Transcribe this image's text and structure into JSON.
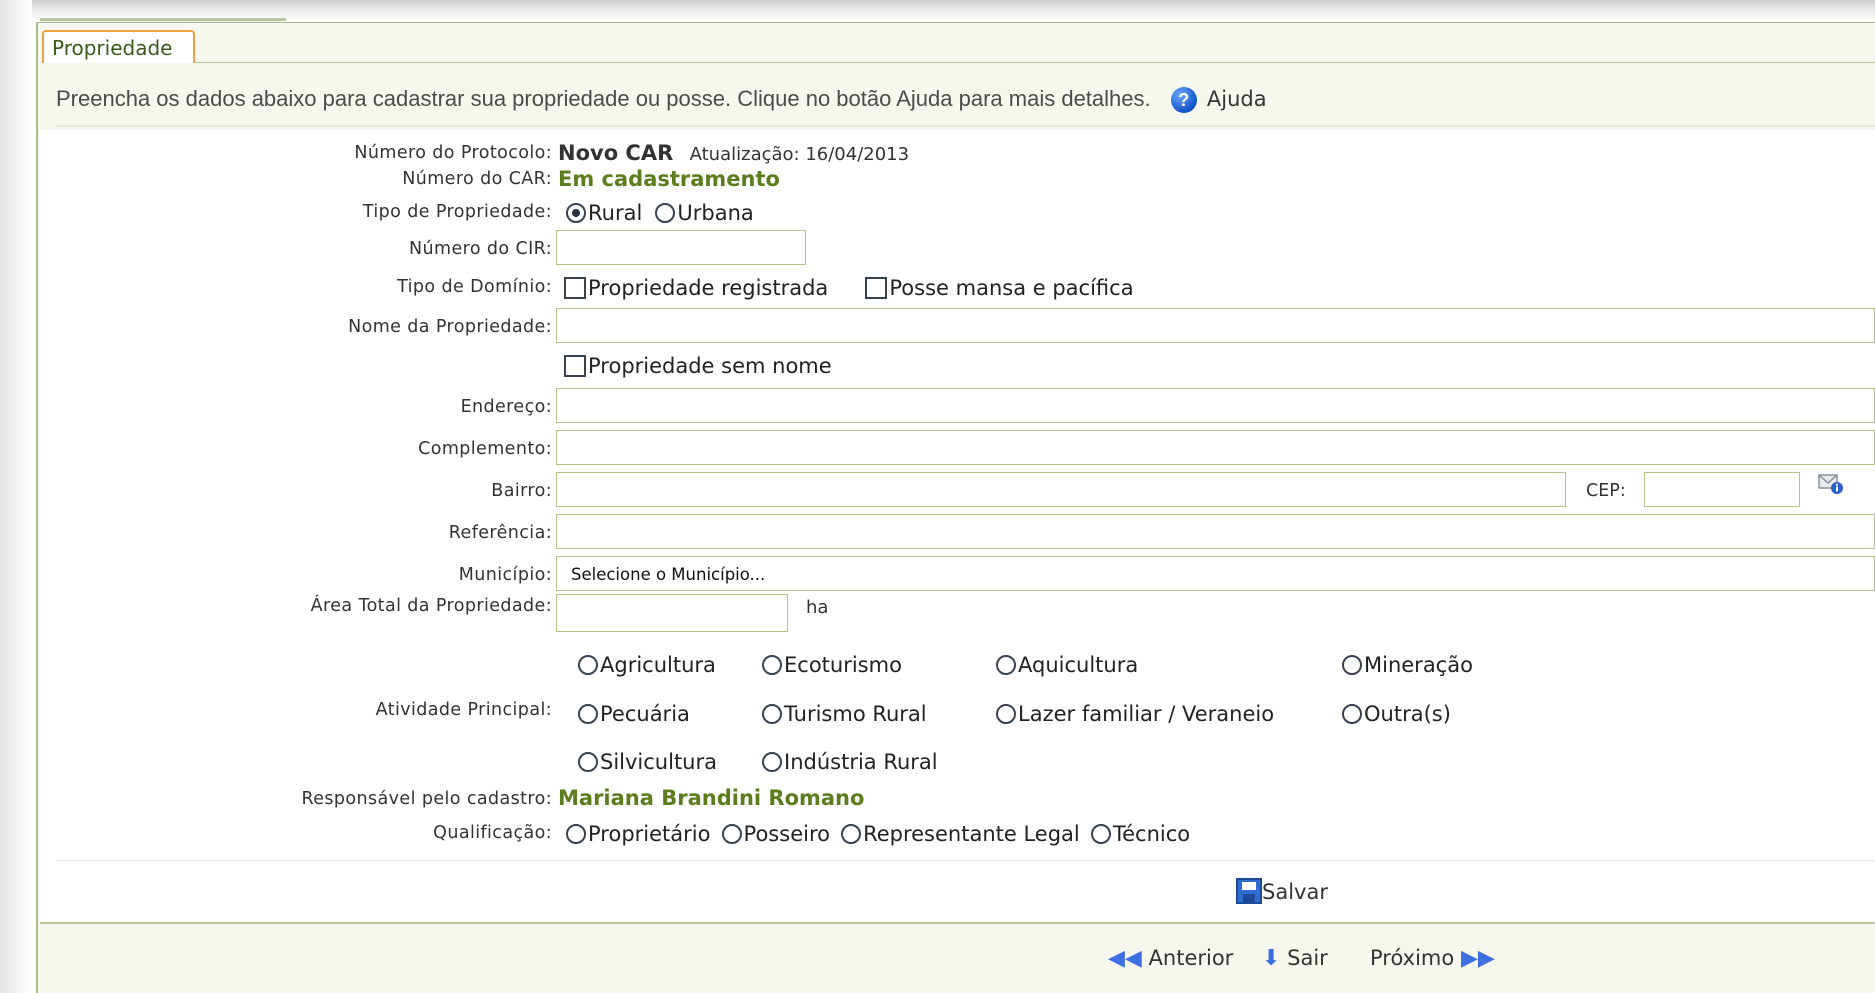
{
  "tab": {
    "label": "Propriedade"
  },
  "instructions": {
    "text": "Preencha os dados abaixo para cadastrar sua propriedade ou posse. Clique no botão Ajuda para mais detalhes.",
    "help_label": "Ajuda"
  },
  "fields": {
    "protocolo": {
      "label": "Número do Protocolo:",
      "value": "Novo CAR",
      "update_text": "Atualização: 16/04/2013"
    },
    "car": {
      "label": "Número do CAR:",
      "value": "Em cadastramento"
    },
    "tipo_propriedade": {
      "label": "Tipo de Propriedade:",
      "options": [
        "Rural",
        "Urbana"
      ],
      "selected": "Rural"
    },
    "cir": {
      "label": "Número do CIR:",
      "value": ""
    },
    "tipo_dominio": {
      "label": "Tipo de Domínio:",
      "options": [
        "Propriedade registrada",
        "Posse mansa e pacífica"
      ]
    },
    "nome": {
      "label": "Nome da Propriedade:",
      "value": "",
      "sem_nome": "Propriedade sem nome"
    },
    "endereco": {
      "label": "Endereço:",
      "value": ""
    },
    "complemento": {
      "label": "Complemento:",
      "value": ""
    },
    "bairro": {
      "label": "Bairro:",
      "value": "",
      "cep_label": "CEP:",
      "cep_value": ""
    },
    "referencia": {
      "label": "Referência:",
      "value": ""
    },
    "municipio": {
      "label": "Município:",
      "selected": "Selecione o Município..."
    },
    "area": {
      "label": "Área Total da Propriedade:",
      "value": "",
      "unit": "ha"
    },
    "atividade": {
      "label": "Atividade Principal:",
      "options": [
        "Agricultura",
        "Ecoturismo",
        "Aquicultura",
        "Mineração",
        "Pecuária",
        "Turismo Rural",
        "Lazer familiar / Veraneio",
        "Outra(s)",
        "Silvicultura",
        "Indústria Rural"
      ]
    },
    "responsavel": {
      "label": "Responsável pelo cadastro:",
      "value": "Mariana Brandini Romano"
    },
    "qualificacao": {
      "label": "Qualificação:",
      "options": [
        "Proprietário",
        "Posseiro",
        "Representante Legal",
        "Técnico"
      ]
    }
  },
  "actions": {
    "save": "Salvar"
  },
  "nav": {
    "previous": "Anterior",
    "exit": "Sair",
    "next": "Próximo"
  },
  "icons": {
    "help": "help-icon",
    "save": "save-icon",
    "cep_lookup": "mail-info-icon",
    "previous": "double-left-arrow-icon",
    "exit": "down-arrow-icon",
    "next": "double-right-arrow-icon"
  },
  "colors": {
    "accent_green": "#5b7d1c",
    "tab_border": "#f0a23c",
    "field_border": "#b4c48f"
  }
}
